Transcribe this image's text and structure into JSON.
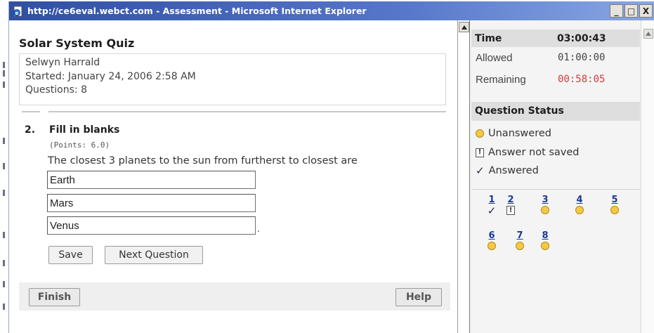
{
  "window": {
    "title": "http://ce6eval.webct.com - Assessment - Microsoft Internet Explorer",
    "minimize": "_",
    "maximize": "□",
    "close": "X"
  },
  "quiz": {
    "title": "Solar System Quiz",
    "student": "Selwyn Harrald",
    "started": "Started: January 24, 2006 2:58 AM",
    "questions": "Questions: 8"
  },
  "question": {
    "number": "2.",
    "type": "Fill in blanks",
    "points": "(Points: 6.0)",
    "text": "The closest 3 planets to the sun from furtherst to closest are",
    "blanks": [
      "Earth",
      "Mars",
      "Venus"
    ],
    "period": "."
  },
  "buttons": {
    "save": "Save",
    "next": "Next Question",
    "finish": "Finish",
    "help": "Help"
  },
  "timer": {
    "label": "Time",
    "value": "03:00:43",
    "allowed_label": "Allowed",
    "allowed_value": "01:00:00",
    "remaining_label": "Remaining",
    "remaining_value": "00:58:05"
  },
  "status": {
    "header": "Question Status",
    "legend": {
      "unanswered": "Unanswered",
      "not_saved": "Answer not saved",
      "answered": "Answered"
    },
    "questions": [
      {
        "num": "1",
        "state": "answered"
      },
      {
        "num": "2",
        "state": "not_saved"
      },
      {
        "num": "3",
        "state": "unanswered"
      },
      {
        "num": "4",
        "state": "unanswered"
      },
      {
        "num": "5",
        "state": "unanswered"
      },
      {
        "num": "6",
        "state": "unanswered"
      },
      {
        "num": "7",
        "state": "unanswered"
      },
      {
        "num": "8",
        "state": "unanswered"
      }
    ]
  },
  "colors": {
    "remaining": "#d23a3a",
    "link": "#1a3a96",
    "unanswered_dot": "#f5c945"
  }
}
